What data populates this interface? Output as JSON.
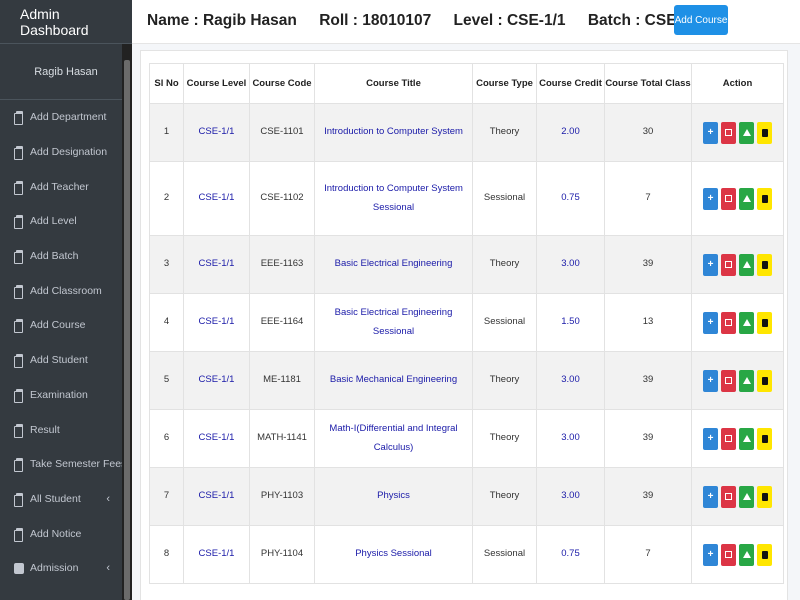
{
  "sidebar": {
    "brand": "Admin Dashboard",
    "user": "Ragib Hasan",
    "items": [
      {
        "label": "Add Department",
        "icon": "document-icon"
      },
      {
        "label": "Add Designation",
        "icon": "document-icon"
      },
      {
        "label": "Add Teacher",
        "icon": "document-icon"
      },
      {
        "label": "Add Level",
        "icon": "document-icon"
      },
      {
        "label": "Add Batch",
        "icon": "document-icon"
      },
      {
        "label": "Add Classroom",
        "icon": "document-icon"
      },
      {
        "label": "Add Course",
        "icon": "document-icon"
      },
      {
        "label": "Add Student",
        "icon": "document-icon"
      },
      {
        "label": "Examination",
        "icon": "document-icon"
      },
      {
        "label": "Result",
        "icon": "document-icon"
      },
      {
        "label": "Take Semester Fees",
        "icon": "document-icon"
      },
      {
        "label": "All Student",
        "icon": "document-icon",
        "chevron": "‹"
      },
      {
        "label": "Add Notice",
        "icon": "document-icon"
      },
      {
        "label": "Admission",
        "icon": "edit-icon",
        "chevron": "‹"
      }
    ]
  },
  "header": {
    "name": "Name : Ragib Hasan",
    "roll": "Roll : 18010107",
    "level": "Level : CSE-1/1",
    "batch": "Batch : CSE-2ND",
    "add_course_label": "Add Course"
  },
  "table": {
    "columns": [
      "Sl No",
      "Course Level",
      "Course Code",
      "Course Title",
      "Course Type",
      "Course Credit",
      "Course Total Class",
      "Action"
    ],
    "rows": [
      {
        "sl": "1",
        "level": "CSE-1/1",
        "code": "CSE-1101",
        "title": "Introduction to Computer System",
        "type": "Theory",
        "credit": "2.00",
        "total": "30"
      },
      {
        "sl": "2",
        "level": "CSE-1/1",
        "code": "CSE-1102",
        "title": "Introduction to Computer System Sessional",
        "type": "Sessional",
        "credit": "0.75",
        "total": "7"
      },
      {
        "sl": "3",
        "level": "CSE-1/1",
        "code": "EEE-1163",
        "title": "Basic Electrical Engineering",
        "type": "Theory",
        "credit": "3.00",
        "total": "39"
      },
      {
        "sl": "4",
        "level": "CSE-1/1",
        "code": "EEE-1164",
        "title": "Basic Electrical Engineering Sessional",
        "type": "Sessional",
        "credit": "1.50",
        "total": "13"
      },
      {
        "sl": "5",
        "level": "CSE-1/1",
        "code": "ME-1181",
        "title": "Basic Mechanical Engineering",
        "type": "Theory",
        "credit": "3.00",
        "total": "39"
      },
      {
        "sl": "6",
        "level": "CSE-1/1",
        "code": "MATH-1141",
        "title": "Math-I(Differential and Integral Calculus)",
        "type": "Theory",
        "credit": "3.00",
        "total": "39"
      },
      {
        "sl": "7",
        "level": "CSE-1/1",
        "code": "PHY-1103",
        "title": "Physics",
        "type": "Theory",
        "credit": "3.00",
        "total": "39"
      },
      {
        "sl": "8",
        "level": "CSE-1/1",
        "code": "PHY-1104",
        "title": "Physics Sessional",
        "type": "Sessional",
        "credit": "0.75",
        "total": "7"
      }
    ],
    "action_icons": [
      "plus-icon",
      "calendar-icon",
      "home-icon",
      "trash-icon"
    ],
    "action_glyphs": [
      "+",
      "",
      "",
      ""
    ]
  },
  "colors": {
    "sidebar_bg": "#343a40",
    "primary": "#1e90e6",
    "danger": "#dc3545",
    "success": "#28a745",
    "warning": "#ffe600",
    "link_text": "#1a1aa8"
  }
}
